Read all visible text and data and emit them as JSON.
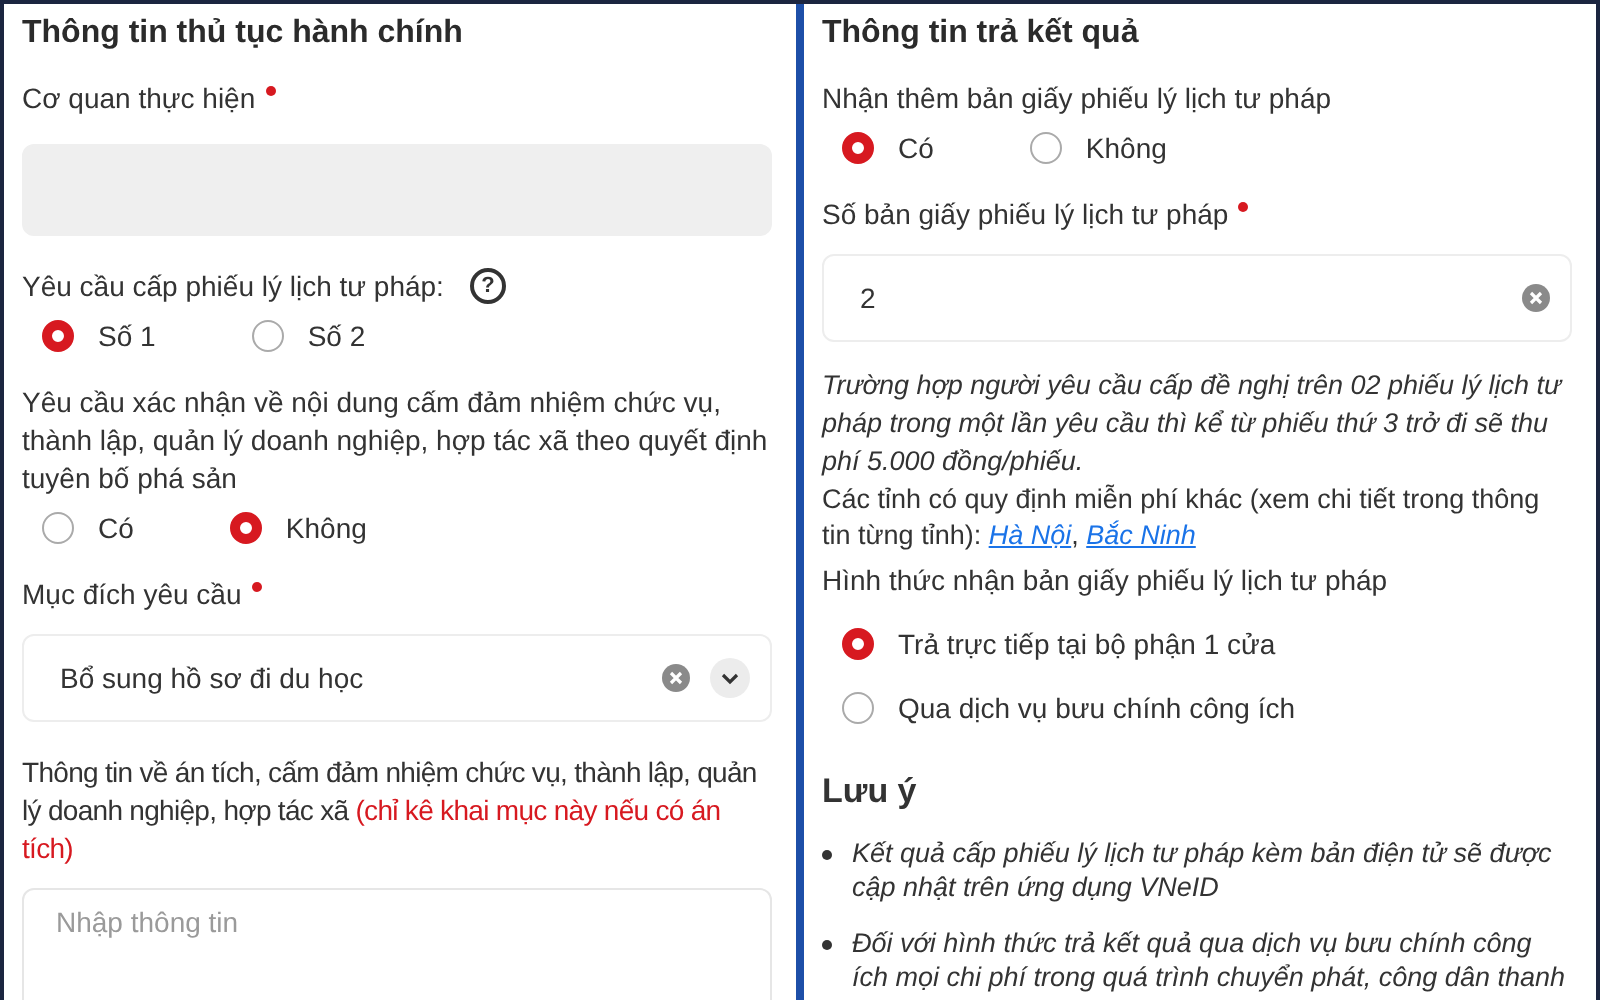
{
  "panels": [
    {
      "title": "Thông tin thủ tục hành chính",
      "items": [
        {
          "kind": "input",
          "label": "Cơ quan thực hiện",
          "required": true,
          "disabled": true
        },
        {
          "kind": "radio-row",
          "label": "Yêu cầu cấp phiếu lý lịch tư pháp:",
          "help": "?",
          "options": [
            {
              "label": "Số 1",
              "selected": true
            },
            {
              "label": "Số 2",
              "selected": false
            }
          ]
        },
        {
          "kind": "radio-row",
          "label": "Yêu cầu xác nhận về nội dung cấm đảm nhiệm chức vụ, thành lập, quản lý doanh nghiệp, hợp tác xã theo quyết định tuyên bố phá sản",
          "options": [
            {
              "label": "Có",
              "selected": false
            },
            {
              "label": "Không",
              "selected": true
            }
          ]
        },
        {
          "kind": "select",
          "label": "Mục đích yêu cầu",
          "required": true,
          "value": "Bổ sung hồ sơ đi du học"
        },
        {
          "kind": "textarea",
          "label": "Thông tin về án tích, cấm đảm nhiệm chức vụ, thành lập, quản lý doanh nghiệp, hợp tác xã",
          "note": "(chỉ kê khai mục này nếu có án tích)",
          "placeholder": "Nhập thông tin"
        }
      ]
    },
    {
      "title": "Thông tin trả kết quả",
      "items": [
        {
          "kind": "radio-row",
          "label": "Nhận thêm bản giấy phiếu lý lịch tư pháp",
          "options": [
            {
              "label": "Có",
              "selected": true
            },
            {
              "label": "Không",
              "selected": false
            }
          ]
        },
        {
          "kind": "input",
          "label": "Số bản giấy phiếu lý lịch tư pháp",
          "required": true,
          "disabled": false,
          "value": "2"
        },
        {
          "kind": "note",
          "text": "Trường hợp người yêu cầu cấp đề nghị trên 02 phiếu lý lịch tư pháp trong một lần yêu cầu thì kể từ phiếu thứ 3 trở đi sẽ thu phí 5.000 đồng/phiếu."
        },
        {
          "kind": "links",
          "parts": [
            {
              "kind": "text",
              "text": "Các tỉnh có quy định miễn phí khác (xem chi tiết trong thông tin từng tỉnh): "
            },
            {
              "kind": "link",
              "text": "Hà Nội"
            },
            {
              "kind": "text",
              "text": ", "
            },
            {
              "kind": "link",
              "text": "Bắc Ninh"
            }
          ]
        },
        {
          "kind": "radio-column",
          "label": "Hình thức nhận bản giấy phiếu lý lịch tư pháp",
          "options": [
            {
              "label": "Trả trực tiếp tại bộ phận 1 cửa",
              "selected": true
            },
            {
              "label": "Qua dịch vụ bưu chính công ích",
              "selected": false
            }
          ]
        },
        {
          "kind": "bullets",
          "title": "Lưu ý",
          "items": [
            "Kết quả cấp phiếu lý lịch tư pháp kèm bản điện tử sẽ được cập nhật trên ứng dụng VNeID",
            "Đối với hình thức trả kết quả qua dịch vụ bưu chính công ích mọi chi phí trong quá trình chuyển phát, công dân thanh"
          ]
        }
      ]
    }
  ]
}
